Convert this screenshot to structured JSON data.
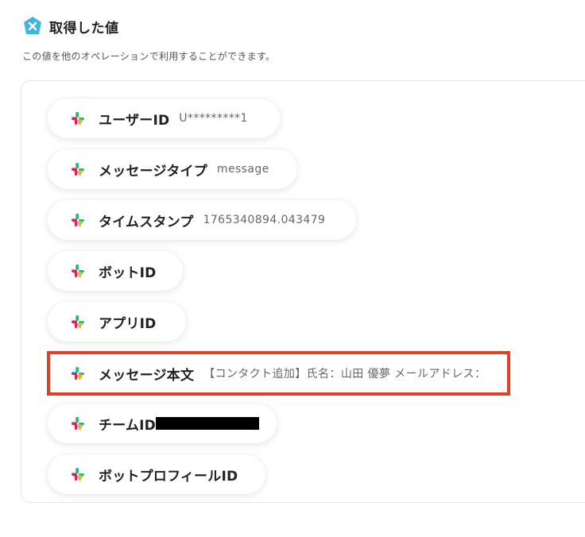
{
  "header": {
    "title": "取得した値",
    "subtitle": "この値を他のオペレーションで利用することができます。",
    "logo_icon": "yoom-x-icon",
    "accent_color": "#3fb6de"
  },
  "fields": [
    {
      "label": "ユーザーID",
      "value": "U*********1",
      "icon": "slack-icon"
    },
    {
      "label": "メッセージタイプ",
      "value": "message",
      "icon": "slack-icon"
    },
    {
      "label": "タイムスタンプ",
      "value": "1765340894.043479",
      "icon": "slack-icon"
    },
    {
      "label": "ボットID",
      "value": "",
      "icon": "slack-icon"
    },
    {
      "label": "アプリID",
      "value": "",
      "icon": "slack-icon"
    },
    {
      "label": "メッセージ本文",
      "value": "【コンタクト追加】氏名：山田 優夢 メールアドレス：",
      "icon": "slack-icon",
      "highlighted": true
    },
    {
      "label": "チームID",
      "value": "",
      "icon": "slack-icon",
      "redacted": true
    },
    {
      "label": "ボットプロフィールID",
      "value": "",
      "icon": "slack-icon"
    }
  ],
  "highlight_color": "#e0402a"
}
